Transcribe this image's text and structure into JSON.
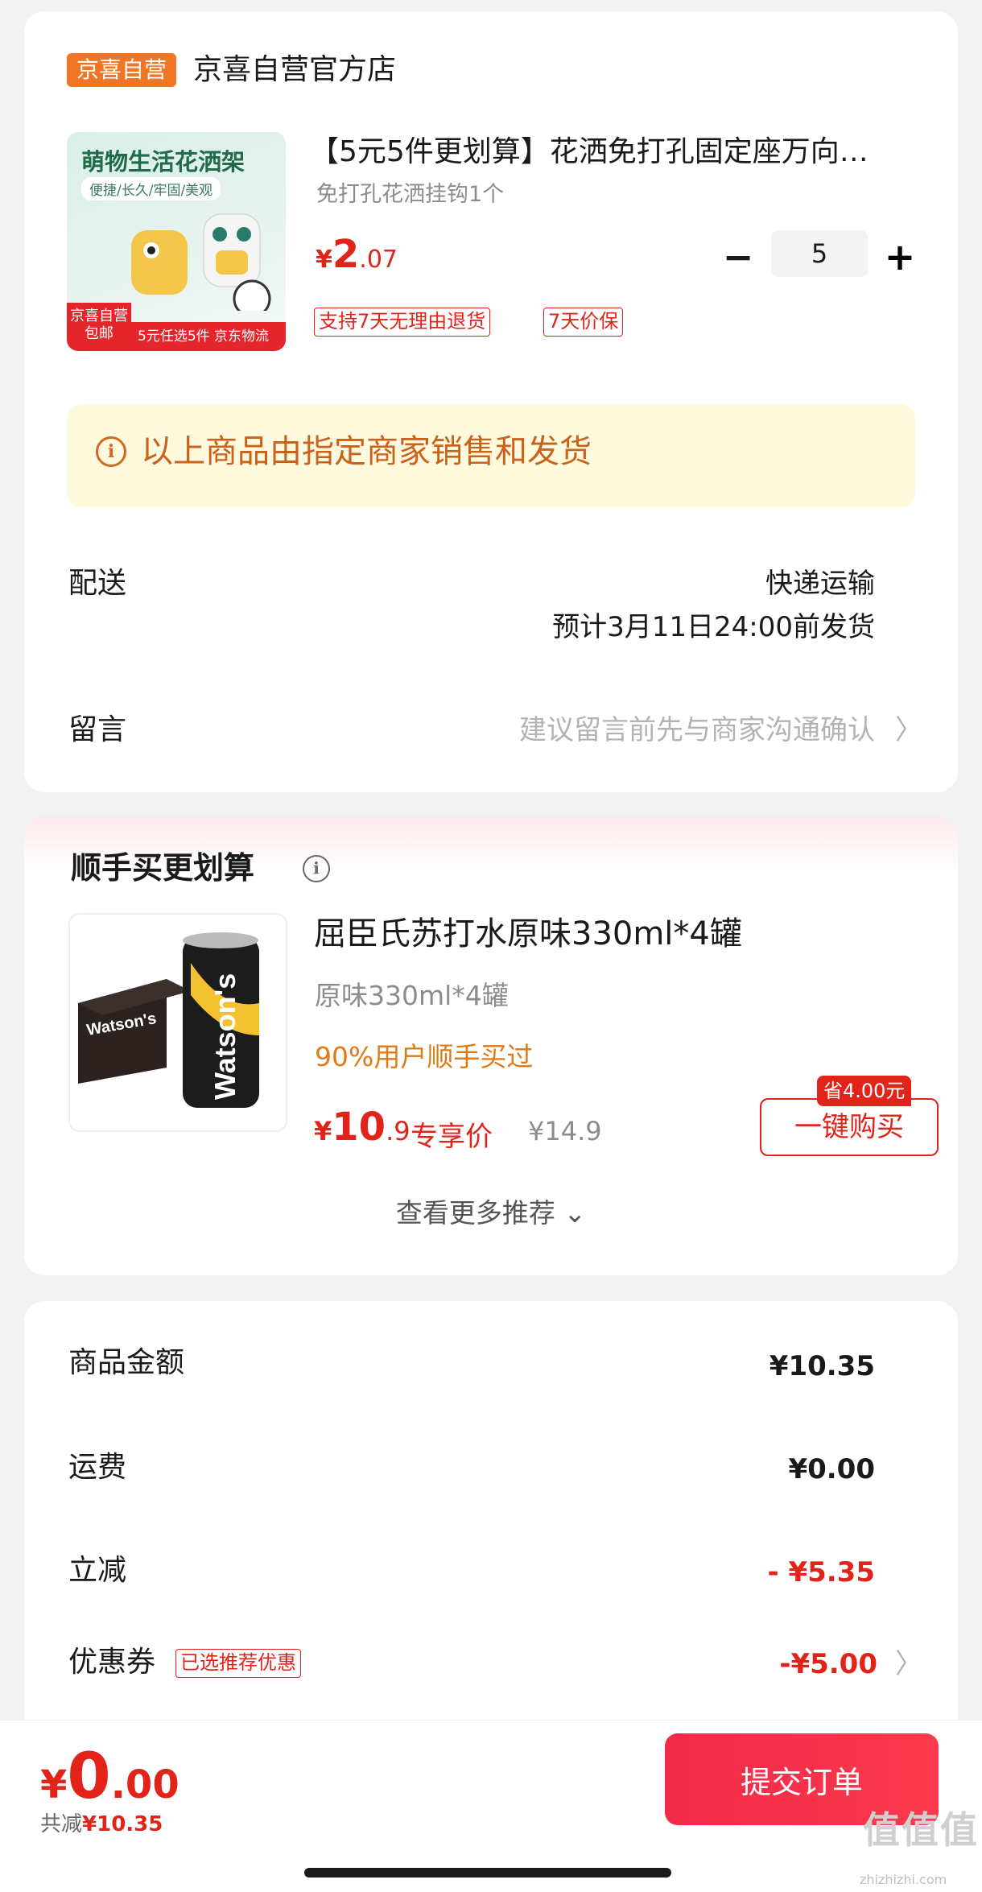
{
  "store": {
    "badge": "京喜自营",
    "name": "京喜自营官方店"
  },
  "product1": {
    "thumb_title": "萌物生活花洒架",
    "thumb_sub": "便捷/长久/牢固/美观",
    "thumb_badge_top": "京喜自营",
    "thumb_badge_bottom": "包邮",
    "thumb_strip": "5元任选5件 京东物流",
    "title": "【5元5件更划算】花洒免打孔固定座万向…",
    "spec": "免打孔花洒挂钩1个",
    "price_symbol": "¥",
    "price_int": "2",
    "price_dec": ".07",
    "quantity": "5",
    "minus": "−",
    "plus": "+",
    "tags": [
      "支持7天无理由退货",
      "7天价保"
    ]
  },
  "notice": {
    "icon": "info-icon",
    "text": "以上商品由指定商家销售和发货"
  },
  "delivery": {
    "label": "配送",
    "method": "快递运输",
    "eta": "预计3月11日24:00前发货"
  },
  "message": {
    "label": "留言",
    "placeholder": "建议留言前先与商家沟通确认",
    "chevron": "〉"
  },
  "recommend": {
    "title": "顺手买更划算",
    "product": {
      "thumb_brand": "Watson's",
      "title": "屈臣氏苏打水原味330ml*4罐",
      "spec": "原味330ml*4罐",
      "hint": "90%用户顺手买过",
      "price_symbol": "¥",
      "price_int": "10",
      "price_dec": ".9",
      "price_label": "专享价",
      "original_price": "¥14.9",
      "save_badge": "省4.00元",
      "buy_label": "一键购买"
    },
    "more": "查看更多推荐 ⌄"
  },
  "summary": {
    "rows": [
      {
        "label": "商品金额",
        "value": "¥10.35"
      },
      {
        "label": "运费",
        "value": "¥0.00"
      },
      {
        "label": "立减",
        "value": "- ¥5.35"
      },
      {
        "label": "优惠券",
        "tag": "已选推荐优惠",
        "value": "-¥5.00",
        "chevron": "〉"
      }
    ]
  },
  "bottom": {
    "price_symbol": "¥",
    "price_int": "0",
    "price_dec": ".00",
    "saved_label": "共减",
    "saved_value": "¥10.35",
    "submit": "提交订单"
  },
  "watermark": {
    "text": "值值值",
    "url": "zhizhizhi.com"
  },
  "colors": {
    "accent": "#e2231a",
    "store_badge": "#f07524",
    "notice_bg": "#fff9dd",
    "notice_text": "#c9631c"
  }
}
